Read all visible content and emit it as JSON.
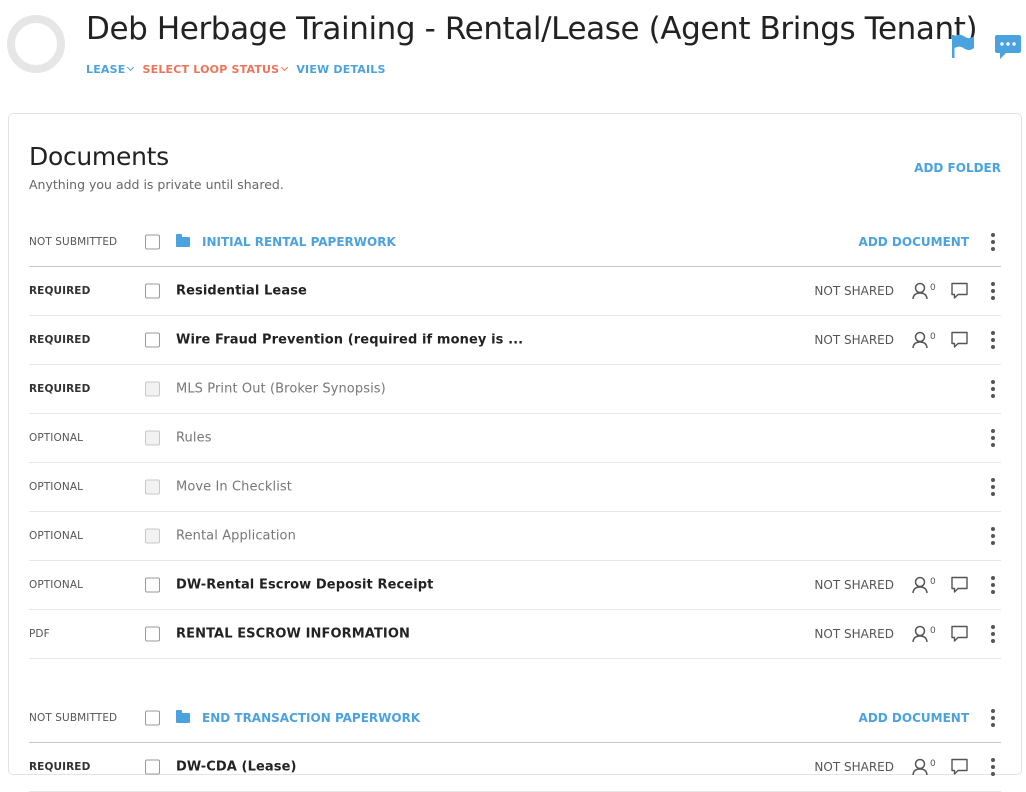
{
  "header": {
    "title": "Deb Herbage Training - Rental/Lease (Agent Brings Tenant)",
    "nav": {
      "lease": "LEASE",
      "status": "SELECT LOOP STATUS",
      "details": "VIEW DETAILS"
    }
  },
  "documents": {
    "title": "Documents",
    "subtitle": "Anything you add is private until shared.",
    "add_folder": "ADD FOLDER"
  },
  "folders": [
    {
      "status": "NOT SUBMITTED",
      "name": "INITIAL RENTAL PAPERWORK",
      "add_label": "ADD DOCUMENT"
    },
    {
      "status": "NOT SUBMITTED",
      "name": "END TRANSACTION PAPERWORK",
      "add_label": "ADD DOCUMENT"
    }
  ],
  "rows": [
    {
      "status": "REQUIRED",
      "name": "Residential Lease",
      "shared": "NOT SHARED",
      "people_count": "0"
    },
    {
      "status": "REQUIRED",
      "name": "Wire Fraud Prevention (required if money is ...",
      "shared": "NOT SHARED",
      "people_count": "0"
    },
    {
      "status": "REQUIRED",
      "name": "MLS Print Out (Broker Synopsis)"
    },
    {
      "status": "OPTIONAL",
      "name": "Rules"
    },
    {
      "status": "OPTIONAL",
      "name": "Move In Checklist"
    },
    {
      "status": "OPTIONAL",
      "name": "Rental Application"
    },
    {
      "status": "OPTIONAL",
      "name": "DW-Rental Escrow Deposit Receipt",
      "shared": "NOT SHARED",
      "people_count": "0"
    },
    {
      "status": "PDF",
      "name": "RENTAL ESCROW INFORMATION",
      "shared": "NOT SHARED",
      "people_count": "0"
    },
    {
      "status": "REQUIRED",
      "name": "DW-CDA (Lease)",
      "shared": "NOT SHARED",
      "people_count": "0"
    }
  ],
  "colors": {
    "accent": "#4aa3df",
    "status_accent": "#f07358"
  },
  "icons": {
    "flag": "flag-icon",
    "chat": "chat-icon",
    "people": "people-icon",
    "comment": "comment-icon",
    "more": "kebab-menu-icon",
    "folder": "folder-icon"
  }
}
